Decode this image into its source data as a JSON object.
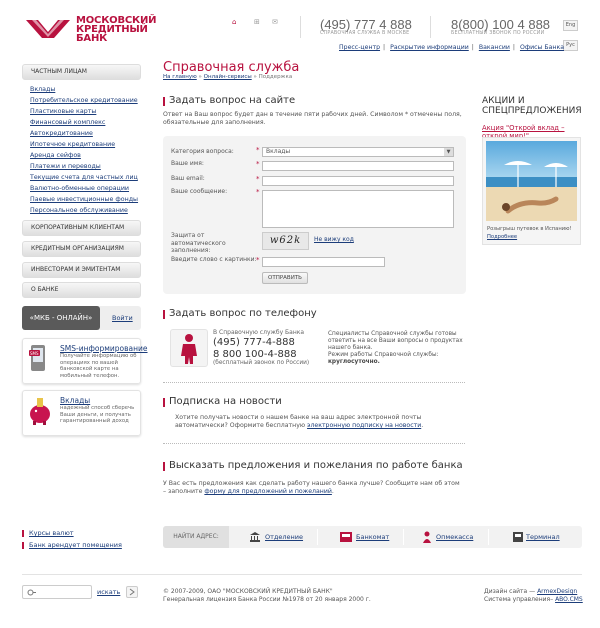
{
  "header": {
    "logo_line1": "МОСКОВСКИЙ",
    "logo_line2": "КРЕДИТНЫЙ",
    "logo_line3": "БАНК",
    "phone1": "(495) 777 4 888",
    "phone1_sub": "СПРАВОЧНАЯ СЛУЖБА В МОСКВЕ",
    "phone2": "8(800) 100 4 888",
    "phone2_sub": "БЕСПЛАТНЫЙ ЗВОНОК ПО РОССИИ",
    "lang_en": "Eng",
    "lang_ru": "Рус",
    "nav": [
      "Пресс-центр",
      "Раскрытие информации",
      "Вакансии",
      "Офисы Банка"
    ]
  },
  "sidebar": {
    "private": "ЧАСТНЫМ ЛИЦАМ",
    "items": [
      "Вклады",
      "Потребительское кредитование",
      "Пластиковые карты",
      "Финансовый комплекс",
      "Автокредитование",
      "Ипотечное кредитование",
      "Аренда сейфов",
      "Платежи и переводы",
      "Текущие счета для частных лиц",
      "Валютно-обменные операции",
      "Паевые инвестиционные фонды",
      "Персональное обслуживание"
    ],
    "corporate": "КОРПОРАТИВНЫМ КЛИЕНТАМ",
    "credit_orgs": "КРЕДИТНЫМ ОРГАНИЗАЦИЯМ",
    "investors": "ИНВЕСТОРАМ И ЭМИТЕНТАМ",
    "about": "О БАНКЕ",
    "online_btn": "«МКБ - ОНЛАЙН»",
    "login": "Войти",
    "sms_title": "SMS-информирование",
    "sms_text": "Получайте информацию об операциях по вашей банковской карте на мобильный телефон.",
    "deposit_title": "Вклады",
    "deposit_text": "надежный способ сберечь Ваши деньги, и получать гарантированный доход",
    "rates": "Курсы валют",
    "lease": "Банк арендует помещения",
    "search_btn": "искать"
  },
  "main": {
    "title": "Справочная служба",
    "crumb_home": "На главную",
    "crumb_online": "Онлайн-сервисы",
    "crumb_current": "Поддержка",
    "ask_title": "Задать вопрос на сайте",
    "ask_intro": "Ответ на Ваш вопрос будет дан в течение пяти рабочих дней. Символом * отмечены поля, обязательные для заполнения.",
    "form": {
      "category_label": "Категория вопроса:",
      "category_value": "Вклады",
      "name_label": "Ваше имя:",
      "email_label": "Ваш email:",
      "message_label": "Ваше сообщение:",
      "captcha_label": "Защита от автоматического заполнения:",
      "captcha_text": "w62k",
      "captcha_reload": "Не вижу код",
      "word_label": "Введите слово с картинки:",
      "submit": "ОТПРАВИТЬ"
    },
    "phone_title": "Задать вопрос по телефону",
    "phone_intro": "В Справочную службу Банка",
    "phone_msk": "(495) 777-4-888",
    "phone_free": "8 800 100-4-888",
    "phone_free_note": "(бесплатный звонок по России)",
    "phone_desc": "Специалисты Справочной службы готовы ответить на все Ваши вопросы о продуктах нашего банка.",
    "phone_hours_label": "Режим работы Справочной службы:",
    "phone_hours": "круглосуточно.",
    "news_title": "Подписка на новости",
    "news_text": "Хотите получать новости о нашем банке на ваш адрес электронной почты автоматически? Оформите бесплатную",
    "news_link": "электронную подписку на новости",
    "feedback_title": "Высказать предложения и пожелания по работе банка",
    "feedback_text": "У Вас есть предложения как сделать работу нашего банка лучше? Сообщите нам об этом – заполните",
    "feedback_link": "форму для предложений и пожеланий"
  },
  "promo": {
    "title1": "АКЦИИ И",
    "title2": "СПЕЦПРЕДЛОЖЕНИЯ",
    "link": "Акция \"Открой вклад – открой мир!\"",
    "caption": "Розыгрыш путевок в Испанию!",
    "more": "Подробнее"
  },
  "address_bar": {
    "label": "НАЙТИ АДРЕС:",
    "items": [
      "Отделение",
      "Банкомат",
      "Опмекасса",
      "Терминал"
    ]
  },
  "footer": {
    "copyright": "© 2007-2009, ОАО \"МОСКОВСКИЙ КРЕДИТНЫЙ БАНК\"",
    "license": "Генеральная лицензия Банка России №1978 от 20 января 2000 г.",
    "design_label": "Дизайн сайта —",
    "design_link": "ArmexDesign",
    "cms_label": "Система управления–",
    "cms_link": "ABO.CMS"
  },
  "colors": {
    "brand": "#b8123f",
    "link": "#1c3d7a"
  }
}
